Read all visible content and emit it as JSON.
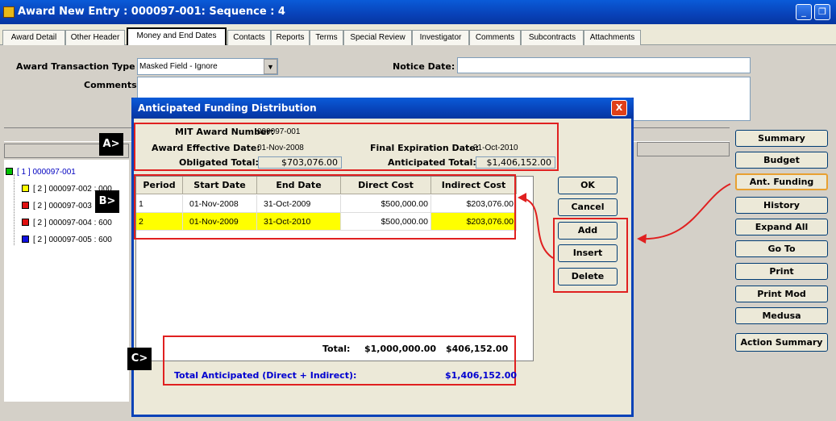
{
  "window": {
    "title": "Award New Entry : 000097-001: Sequence : 4",
    "minimize": "_",
    "restore": "❐"
  },
  "tabs": [
    "Award Detail",
    "Other Header",
    "Money and End Dates",
    "Contacts",
    "Reports",
    "Terms",
    "Special Review",
    "Investigator",
    "Comments",
    "Subcontracts",
    "Attachments"
  ],
  "form": {
    "transaction_type_label": "Award Transaction Type :",
    "transaction_type_value": "Masked Field - Ignore",
    "notice_date_label": "Notice Date:",
    "notice_date_value": "",
    "comments_label": "Comments :"
  },
  "tree": [
    {
      "label": "[ 1 ] 000097-001",
      "color": "#00c000"
    },
    {
      "label": "[ 2 ] 000097-002 : 000",
      "color": "#ffff00"
    },
    {
      "label": "[ 2 ] 000097-003",
      "color": "#e01010"
    },
    {
      "label": "[ 2 ] 000097-004 : 600",
      "color": "#e01010"
    },
    {
      "label": "[ 2 ] 000097-005 : 600",
      "color": "#1010e0"
    }
  ],
  "sidebar": [
    "Summary",
    "Budget",
    "Ant. Funding",
    "History",
    "Expand All",
    "Go To",
    "Print",
    "Print Mod",
    "Medusa",
    "Action Summary"
  ],
  "dialog": {
    "title": "Anticipated Funding Distribution",
    "close": "X",
    "award_number_label": "MIT Award Number:",
    "award_number": "000097-001",
    "effective_label": "Award Effective Date:",
    "effective_date": "01-Nov-2008",
    "final_exp_label": "Final Expiration Date:",
    "final_exp_date": "31-Oct-2010",
    "obligated_label": "Obligated Total:",
    "obligated_total": "$703,076.00",
    "anticipated_label": "Anticipated Total:",
    "anticipated_total": "$1,406,152.00",
    "columns": [
      "Period",
      "Start Date",
      "End Date",
      "Direct Cost",
      "Indirect Cost"
    ],
    "rows": [
      {
        "period": "1",
        "start": "01-Nov-2008",
        "end": "31-Oct-2009",
        "direct": "$500,000.00",
        "indirect": "$203,076.00"
      },
      {
        "period": "2",
        "start": "01-Nov-2009",
        "end": "31-Oct-2010",
        "direct": "$500,000.00",
        "indirect": "$203,076.00"
      }
    ],
    "buttons": [
      "OK",
      "Cancel",
      "Add",
      "Insert",
      "Delete"
    ],
    "total_label": "Total:",
    "total_direct": "$1,000,000.00",
    "total_indirect": "$406,152.00",
    "grand_label": "Total  Anticipated (Direct + Indirect):",
    "grand_total": "$1,406,152.00"
  },
  "callouts": [
    "A>",
    "B>",
    "C>"
  ]
}
